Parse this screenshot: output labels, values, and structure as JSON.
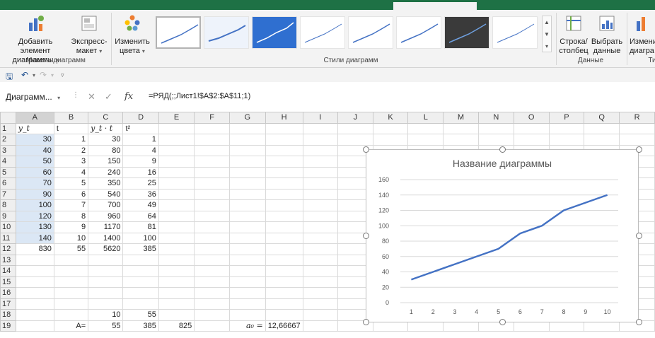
{
  "ribbon": {
    "add_element": {
      "line1": "Добавить элемент",
      "line2": "диаграммы"
    },
    "quick_layout": {
      "line1": "Экспресс-",
      "line2": "макет"
    },
    "change_colors": {
      "line1": "Изменить",
      "line2": "цвета"
    },
    "group_layouts": "Макеты диаграмм",
    "group_styles": "Стили диаграмм",
    "row_col": {
      "line1": "Строка/",
      "line2": "столбец"
    },
    "select_data": {
      "line1": "Выбрать",
      "line2": "данные"
    },
    "group_data": "Данные",
    "change_type": {
      "line1": "Измени",
      "line2": "диагра"
    },
    "group_type": "Ти"
  },
  "formula_bar": {
    "name_box": "Диаграмм...",
    "fx": "fx",
    "formula": "=РЯД(;;Лист1!$A$2:$A$11;1)"
  },
  "sheet": {
    "columns": [
      "A",
      "B",
      "C",
      "D",
      "E",
      "F",
      "G",
      "H",
      "I",
      "J",
      "K",
      "L",
      "M",
      "N",
      "O",
      "P",
      "Q",
      "R"
    ],
    "rows": [
      {
        "n": "1",
        "a": "y_t",
        "b": "t",
        "c": "y_t · t",
        "d": "t²",
        "e": "",
        "g": "",
        "h": ""
      },
      {
        "n": "2",
        "a": "30",
        "b": "1",
        "c": "30",
        "d": "1",
        "e": "",
        "g": "",
        "h": ""
      },
      {
        "n": "3",
        "a": "40",
        "b": "2",
        "c": "80",
        "d": "4",
        "e": "",
        "g": "",
        "h": ""
      },
      {
        "n": "4",
        "a": "50",
        "b": "3",
        "c": "150",
        "d": "9",
        "e": "",
        "g": "",
        "h": ""
      },
      {
        "n": "5",
        "a": "60",
        "b": "4",
        "c": "240",
        "d": "16",
        "e": "",
        "g": "",
        "h": ""
      },
      {
        "n": "6",
        "a": "70",
        "b": "5",
        "c": "350",
        "d": "25",
        "e": "",
        "g": "",
        "h": ""
      },
      {
        "n": "7",
        "a": "90",
        "b": "6",
        "c": "540",
        "d": "36",
        "e": "",
        "g": "",
        "h": ""
      },
      {
        "n": "8",
        "a": "100",
        "b": "7",
        "c": "700",
        "d": "49",
        "e": "",
        "g": "",
        "h": ""
      },
      {
        "n": "9",
        "a": "120",
        "b": "8",
        "c": "960",
        "d": "64",
        "e": "",
        "g": "",
        "h": ""
      },
      {
        "n": "10",
        "a": "130",
        "b": "9",
        "c": "1170",
        "d": "81",
        "e": "",
        "g": "",
        "h": ""
      },
      {
        "n": "11",
        "a": "140",
        "b": "10",
        "c": "1400",
        "d": "100",
        "e": "",
        "g": "",
        "h": ""
      },
      {
        "n": "12",
        "a": "830",
        "b": "55",
        "c": "5620",
        "d": "385",
        "e": "",
        "g": "",
        "h": ""
      },
      {
        "n": "13",
        "a": "",
        "b": "",
        "c": "",
        "d": "",
        "e": "",
        "g": "",
        "h": ""
      },
      {
        "n": "14",
        "a": "",
        "b": "",
        "c": "",
        "d": "",
        "e": "",
        "g": "",
        "h": ""
      },
      {
        "n": "15",
        "a": "",
        "b": "",
        "c": "",
        "d": "",
        "e": "",
        "g": "",
        "h": ""
      },
      {
        "n": "16",
        "a": "",
        "b": "",
        "c": "",
        "d": "",
        "e": "",
        "g": "",
        "h": ""
      },
      {
        "n": "17",
        "a": "",
        "b": "",
        "c": "",
        "d": "",
        "e": "",
        "g": "",
        "h": ""
      },
      {
        "n": "18",
        "a": "",
        "b": "",
        "c": "10",
        "d": "55",
        "e": "",
        "g": "",
        "h": ""
      },
      {
        "n": "19",
        "a": "",
        "b": "A=",
        "c": "55",
        "d": "385",
        "e": "825",
        "g": "a₀ =",
        "h": "12,66667"
      }
    ]
  },
  "colors": {
    "accent_green": "#1e7145",
    "series_blue": "#4472c4",
    "selection_fill": "#dbe7f5"
  },
  "chart_data": {
    "type": "line",
    "title": "Название диаграммы",
    "categories": [
      "1",
      "2",
      "3",
      "4",
      "5",
      "6",
      "7",
      "8",
      "9",
      "10"
    ],
    "series": [
      {
        "values": [
          30,
          40,
          50,
          60,
          70,
          90,
          100,
          120,
          130,
          140
        ]
      }
    ],
    "ylim": [
      0,
      160
    ],
    "yticks": [
      "0",
      "20",
      "40",
      "60",
      "80",
      "100",
      "120",
      "140",
      "160"
    ],
    "grid": true,
    "legend": "none"
  }
}
